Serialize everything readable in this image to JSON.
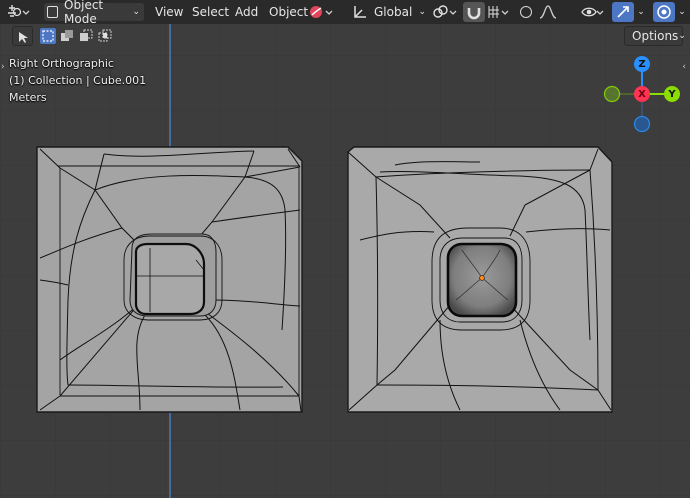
{
  "header": {
    "mode": "Object Mode",
    "menus": [
      "View",
      "Select",
      "Add",
      "Object"
    ],
    "orientation": "Global",
    "options_label": "Options"
  },
  "overlay_info": {
    "view_name": "Right Orthographic",
    "collection": "(1) Collection | Cube.001",
    "units": "Meters"
  },
  "gizmo": {
    "z_label": "Z",
    "y_label": "Y",
    "x_label": "X",
    "colors": {
      "x": "#ff3352",
      "y": "#8bdc00",
      "z": "#2890ff"
    }
  },
  "icons": [
    "editor-type-icon",
    "object-mode-icon",
    "material-sphere-icon",
    "orientation-icon",
    "pivot-icon",
    "snap-magnet-icon",
    "snap-grid-icon",
    "proportional-falloff-icon",
    "visibility-eye-icon",
    "gizmo-arrow-icon",
    "overlay-icon",
    "select-box-icon"
  ],
  "colors": {
    "viewport_bg": "#3d3d3d",
    "grid_line": "#363636",
    "z_axis_line": "#4b8ad6",
    "mesh_face": "#a6a6a6",
    "mesh_edge": "#111111",
    "origin": "#ff8a1e",
    "active_button": "#4d77c4"
  }
}
